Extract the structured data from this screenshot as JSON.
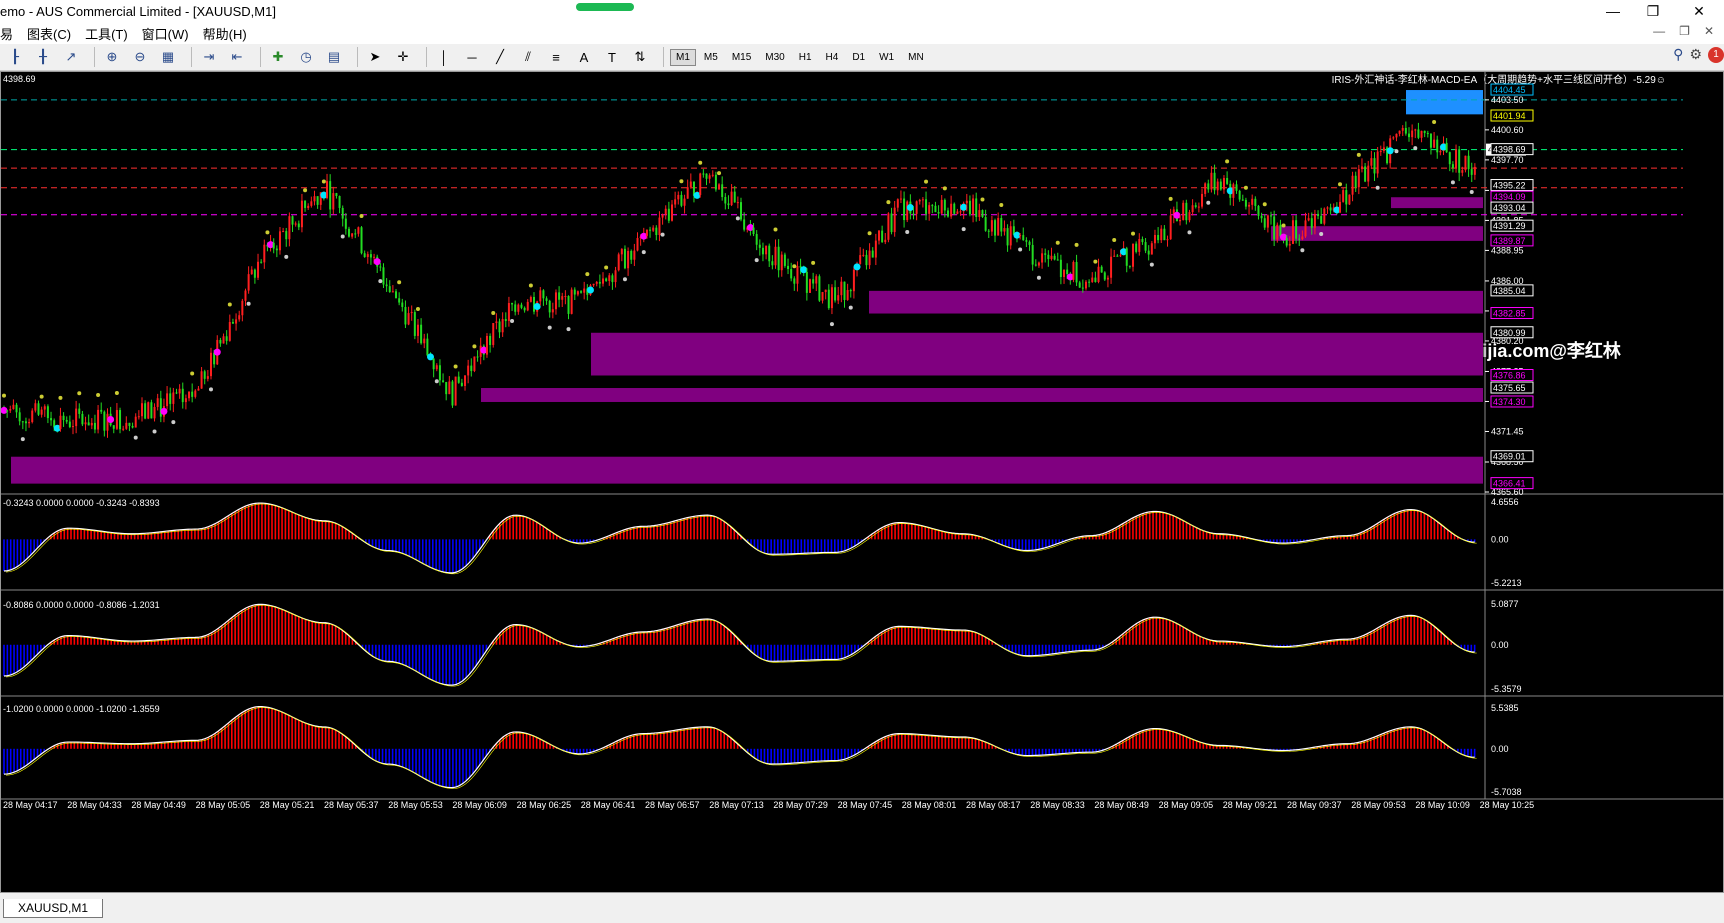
{
  "window": {
    "title": "emo - AUS Commercial Limited - [XAUUSD,M1]",
    "progress": 1.0,
    "minimize": "—",
    "restore": "❐",
    "close": "✕"
  },
  "menu": {
    "items": [
      "易",
      "图表(C)",
      "工具(T)",
      "窗口(W)",
      "帮助(H)"
    ]
  },
  "toolbar": {
    "timeframes": [
      "M1",
      "M5",
      "M15",
      "M30",
      "H1",
      "H4",
      "D1",
      "W1",
      "MN"
    ],
    "active_timeframe": "M1",
    "notification_count": "1",
    "icons": [
      "bar-chart-icon",
      "candlestick-icon",
      "line-chart-icon",
      "zoom-in-icon",
      "zoom-out-icon",
      "tile-icon",
      "scroll-icon",
      "shift-icon",
      "indicators-icon",
      "periods-icon",
      "templates-icon",
      "cursor-icon",
      "crosshair-icon",
      "vline-icon",
      "hline-icon",
      "trendline-icon",
      "channel-icon",
      "fibo-icon",
      "text-icon",
      "label-icon",
      "arrows-icon",
      "search-icon",
      "settings-icon"
    ]
  },
  "chart": {
    "price_corner": "4398.69",
    "ea_label": "IRIS-外汇神话-李红林-MACD-EA（大周期趋势+水平三线区间开仓）-5.29☺",
    "watermark": "www.eazhijia.com@李红林",
    "symbol_tab": "XAUUSD,M1",
    "current_price": "4398.69",
    "colors": {
      "bull": "#ff1f1f",
      "bear": "#22dd22",
      "zone": "#800080",
      "macd_up": "#ff0000",
      "macd_down": "#0000ff",
      "signal": "#ffffff",
      "cyan": "#00e5ff",
      "magenta": "#ff00ff",
      "yellow": "#ffff00"
    }
  },
  "chart_data": [
    {
      "type": "line",
      "name": "XAUUSD M1 price",
      "title": "",
      "xlabel": "",
      "ylabel": "",
      "ylim": [
        4365.6,
        4406.0
      ],
      "y_ticks": [
        "4403.50",
        "4400.60",
        "4397.70",
        "4394.75",
        "4391.85",
        "4388.95",
        "4386.00",
        "4383.10",
        "4380.20",
        "4377.25",
        "4374.35",
        "4371.45",
        "4368.50",
        "4365.60"
      ],
      "x_ticks": [
        "28 May 04:17",
        "28 May 04:33",
        "28 May 04:49",
        "28 May 05:05",
        "28 May 05:21",
        "28 May 05:37",
        "28 May 05:53",
        "28 May 06:09",
        "28 May 06:25",
        "28 May 06:41",
        "28 May 06:57",
        "28 May 07:13",
        "28 May 07:29",
        "28 May 07:45",
        "28 May 08:01",
        "28 May 08:17",
        "28 May 08:33",
        "28 May 08:49",
        "28 May 09:05",
        "28 May 09:21",
        "28 May 09:37",
        "28 May 09:53",
        "28 May 10:09",
        "28 May 10:25"
      ],
      "x": [
        "04:17",
        "04:33",
        "04:49",
        "05:05",
        "05:21",
        "05:37",
        "05:53",
        "06:09",
        "06:25",
        "06:41",
        "06:57",
        "07:13",
        "07:29",
        "07:45",
        "08:01",
        "08:17",
        "08:33",
        "08:49",
        "09:05",
        "09:21",
        "09:37",
        "09:53",
        "10:09",
        "10:25"
      ],
      "values": [
        4373.5,
        4372.5,
        4372.8,
        4375.0,
        4388.0,
        4395.0,
        4386.0,
        4375.0,
        4384.0,
        4384.0,
        4390.0,
        4396.5,
        4388.5,
        4384.0,
        4393.0,
        4393.5,
        4389.0,
        4386.0,
        4390.0,
        4396.0,
        4390.0,
        4394.5,
        4401.0,
        4396.5
      ],
      "levels": [
        {
          "label": "4404.45",
          "color": "#00bfff"
        },
        {
          "label": "4401.94",
          "color": "#ffff00"
        },
        {
          "label": "4398.69",
          "color": "#ffffff"
        },
        {
          "label": "4395.22",
          "color": "#ffffff"
        },
        {
          "label": "4394.09",
          "color": "#ff00ff"
        },
        {
          "label": "4393.04",
          "color": "#ffffff"
        },
        {
          "label": "4391.29",
          "color": "#ffffff"
        },
        {
          "label": "4389.87",
          "color": "#ff00ff"
        },
        {
          "label": "4385.04",
          "color": "#ffffff"
        },
        {
          "label": "4382.85",
          "color": "#ff00ff"
        },
        {
          "label": "4380.99",
          "color": "#ffffff"
        },
        {
          "label": "4376.86",
          "color": "#ff00ff"
        },
        {
          "label": "4375.65",
          "color": "#ffffff"
        },
        {
          "label": "4374.30",
          "color": "#ff00ff"
        },
        {
          "label": "4369.01",
          "color": "#ffffff"
        },
        {
          "label": "4366.41",
          "color": "#ff00ff"
        }
      ],
      "zones": [
        {
          "from": 4366.41,
          "to": 4369.01
        },
        {
          "from": 4374.3,
          "to": 4375.65
        },
        {
          "from": 4376.86,
          "to": 4380.99
        },
        {
          "from": 4382.85,
          "to": 4385.04
        },
        {
          "from": 4389.87,
          "to": 4391.29
        },
        {
          "from": 4393.04,
          "to": 4394.09
        },
        {
          "from": 4402.1,
          "to": 4404.45
        }
      ]
    },
    {
      "type": "bar",
      "name": "MACD 1",
      "header": "-0.3243 0.0000 0.0000 -0.3243 -0.8393",
      "ylim": [
        -5.2213,
        4.6556
      ],
      "y_ticks": [
        "4.6556",
        "0.00",
        "-5.2213"
      ],
      "x": [
        "04:17",
        "04:33",
        "04:49",
        "05:05",
        "05:21",
        "05:37",
        "05:53",
        "06:09",
        "06:25",
        "06:41",
        "06:57",
        "07:13",
        "07:29",
        "07:45",
        "08:01",
        "08:17",
        "08:33",
        "08:49",
        "09:05",
        "09:21",
        "09:37",
        "09:53",
        "10:09",
        "10:25"
      ],
      "values": [
        -3.4,
        1.2,
        0.6,
        1.1,
        3.9,
        2.0,
        -1.2,
        -3.6,
        2.6,
        -0.4,
        1.4,
        2.6,
        -1.6,
        -1.4,
        1.8,
        0.6,
        -1.2,
        0.4,
        3.0,
        0.6,
        -0.4,
        0.4,
        3.2,
        -0.3
      ]
    },
    {
      "type": "bar",
      "name": "MACD 2",
      "header": "-0.8086 0.0000 0.0000 -0.8086 -1.2031",
      "ylim": [
        -5.3579,
        5.0877
      ],
      "y_ticks": [
        "5.0877",
        "0.00",
        "-5.3579"
      ],
      "x": [
        "04:17",
        "04:33",
        "04:49",
        "05:05",
        "05:21",
        "05:37",
        "05:53",
        "06:09",
        "06:25",
        "06:41",
        "06:57",
        "07:13",
        "07:29",
        "07:45",
        "08:01",
        "08:17",
        "08:33",
        "08:49",
        "09:05",
        "09:21",
        "09:37",
        "09:53",
        "10:09",
        "10:25"
      ],
      "values": [
        -3.4,
        1.0,
        0.4,
        0.8,
        4.4,
        2.4,
        -1.8,
        -4.4,
        2.2,
        -0.2,
        1.4,
        2.8,
        -1.8,
        -1.6,
        2.0,
        1.6,
        -1.2,
        -0.6,
        3.0,
        0.4,
        -0.2,
        0.6,
        3.2,
        -0.8
      ]
    },
    {
      "type": "bar",
      "name": "MACD 3",
      "header": "-1.0200 0.0000 0.0000 -1.0200 -1.3559",
      "ylim": [
        -5.7038,
        5.5385
      ],
      "y_ticks": [
        "5.5385",
        "0.00",
        "-5.7038"
      ],
      "x": [
        "04:17",
        "04:33",
        "04:49",
        "05:05",
        "05:21",
        "05:37",
        "05:53",
        "06:09",
        "06:25",
        "06:41",
        "06:57",
        "07:13",
        "07:29",
        "07:45",
        "08:01",
        "08:17",
        "08:33",
        "08:49",
        "09:05",
        "09:21",
        "09:37",
        "09:53",
        "10:09",
        "10:25"
      ],
      "values": [
        -3.0,
        0.8,
        0.6,
        1.0,
        5.0,
        2.6,
        -1.8,
        -4.6,
        2.0,
        -0.6,
        1.8,
        2.6,
        -1.8,
        -1.4,
        1.8,
        1.4,
        -0.8,
        -0.4,
        2.4,
        0.4,
        -0.2,
        0.6,
        2.6,
        -1.0
      ]
    }
  ]
}
